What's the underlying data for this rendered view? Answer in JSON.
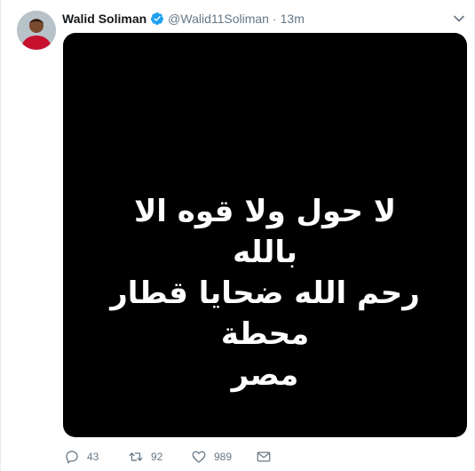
{
  "tweet": {
    "author_name": "Walid Soliman",
    "handle": "@Walid11Soliman",
    "separator": "·",
    "time": "13m"
  },
  "media": {
    "lines": [
      "لا حول ولا قوه الا بالله",
      "رحم الله ضحايا قطار محطة",
      "مصر"
    ]
  },
  "actions": {
    "reply_count": "43",
    "retweet_count": "92",
    "like_count": "989"
  },
  "colors": {
    "verified": "#1da1f2",
    "secondary_text": "#657786",
    "media_bg": "#000000"
  }
}
